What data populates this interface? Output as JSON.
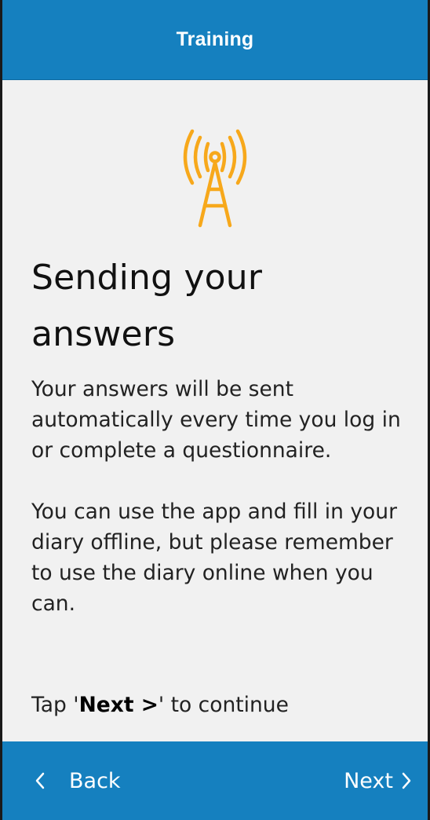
{
  "header": {
    "title": "Training"
  },
  "icon": {
    "name": "signal-tower-icon",
    "color": "#F7A81B"
  },
  "content": {
    "title": "Sending your answers",
    "paragraphs": [
      "Your answers will be sent automatically every time you log in or complete a questionnaire.",
      "You can use the app and fill in your diary offline, but please remember to use the diary online when you can."
    ],
    "tap_prefix": "Tap '",
    "tap_strong": "Next >",
    "tap_suffix": "' to continue"
  },
  "footer": {
    "back_label": "Back",
    "next_label": "Next"
  },
  "colors": {
    "header_bg": "#1580BF",
    "footer_bg": "#1580BF",
    "page_bg": "#F1F1F1",
    "accent": "#F7A81B"
  }
}
